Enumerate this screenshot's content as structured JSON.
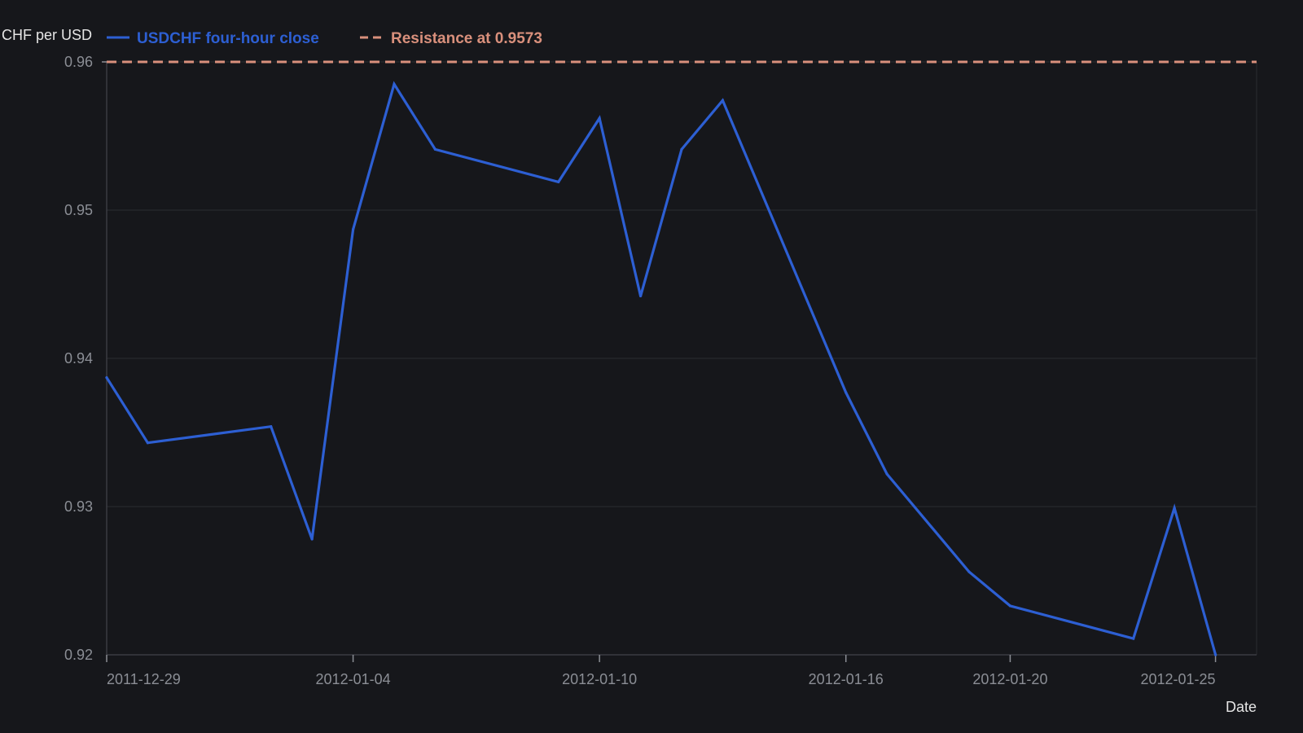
{
  "chart_data": {
    "type": "line",
    "title": "",
    "xlabel": "Date",
    "ylabel": "CHF per USD",
    "ylim": [
      0.92,
      0.96
    ],
    "yticks": [
      0.92,
      0.93,
      0.94,
      0.95,
      0.96
    ],
    "ytick_labels": [
      "0.92",
      "0.93",
      "0.94",
      "0.95",
      "0.96"
    ],
    "xlim": [
      "2011-12-29",
      "2012-01-26"
    ],
    "xticks": [
      "2011-12-29",
      "2012-01-04",
      "2012-01-10",
      "2012-01-16",
      "2012-01-20",
      "2012-01-25"
    ],
    "grid": true,
    "legend": {
      "placement": "top-left",
      "entries": [
        "USDCHF four-hour close",
        "Resistance at 0.9573"
      ]
    },
    "series": [
      {
        "name": "USDCHF four-hour close",
        "color": "#2d5fd3",
        "style": "solid",
        "x": [
          "2011-12-29",
          "2011-12-30",
          "2012-01-02",
          "2012-01-03",
          "2012-01-04",
          "2012-01-05",
          "2012-01-06",
          "2012-01-09",
          "2012-01-10",
          "2012-01-11",
          "2012-01-12",
          "2012-01-13",
          "2012-01-16",
          "2012-01-17",
          "2012-01-19",
          "2012-01-20",
          "2012-01-23",
          "2012-01-24",
          "2012-01-25"
        ],
        "values": [
          0.9387,
          0.9343,
          0.9354,
          0.9278,
          0.9487,
          0.9585,
          0.9541,
          0.9519,
          0.9562,
          0.9442,
          0.9541,
          0.9574,
          0.9377,
          0.9322,
          0.9256,
          0.9233,
          0.9211,
          0.9299,
          0.92
        ]
      },
      {
        "name": "Resistance at 0.9573",
        "color": "#d9907c",
        "style": "dashed",
        "constant": 0.96
      }
    ]
  }
}
